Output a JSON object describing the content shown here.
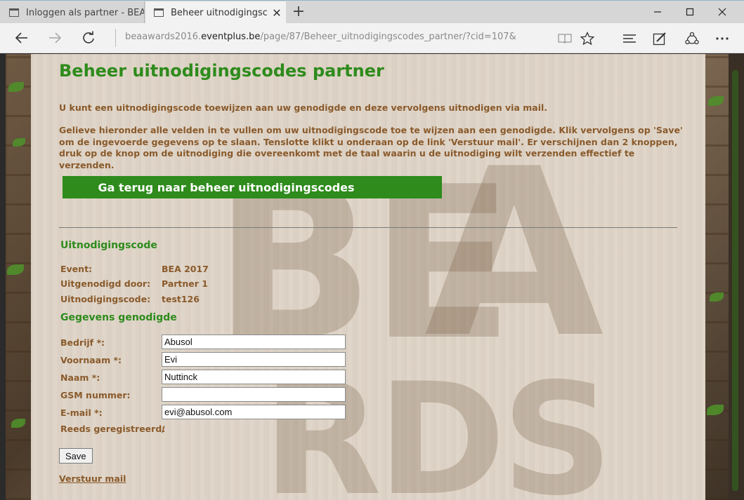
{
  "browser": {
    "tabs": [
      {
        "label": "Inloggen als partner - BEA A"
      },
      {
        "label": "Beheer uitnodigingscod"
      }
    ],
    "address": {
      "prefix": "beaawards2016.",
      "host": "eventplus.be",
      "path": "/page/87/Beheer_uitnodigingscodes_partner/?cid=107&"
    }
  },
  "page": {
    "title": "Beheer uitnodigingscodes partner",
    "intro1": "U kunt een uitnodigingscode toewijzen aan uw genodigde en deze vervolgens uitnodigen via mail.",
    "intro2": "Gelieve hieronder alle velden in te vullen om uw uitnodigingscode toe te wijzen aan een genodigde. Klik vervolgens op 'Save' om de ingevoerde gegevens op te slaan. Tenslotte klikt u onderaan op de link 'Verstuur mail'. Er verschijnen dan 2 knoppen, druk op de knop om de uitnodiging die overeenkomt met de taal waarin u de uitnodiging wilt verzenden effectief te verzenden.",
    "back_button": "Ga terug naar beheer uitnodigingscodes"
  },
  "code_section": {
    "title": "Uitnodigingscode",
    "rows": [
      {
        "label": "Event:",
        "value": "BEA 2017"
      },
      {
        "label": "Uitgenodigd door:",
        "value": "Partner 1"
      },
      {
        "label": "Uitnodigingscode:",
        "value": "test126"
      }
    ]
  },
  "guest_section": {
    "title": "Gegevens genodigde",
    "fields": [
      {
        "label": "Bedrijf *:",
        "value": "Abusol"
      },
      {
        "label": "Voornaam *:",
        "value": "Evi"
      },
      {
        "label": "Naam *:",
        "value": "Nuttinck"
      },
      {
        "label": "GSM nummer:",
        "value": ""
      },
      {
        "label": "E-mail *:",
        "value": "evi@abusol.com"
      }
    ],
    "registered_label": "Reeds geregistreerd:",
    "registered_value": "/"
  },
  "actions": {
    "save": "Save",
    "send_mail": "Verstuur mail"
  },
  "colors": {
    "accent_green": "#2e8b1c",
    "text_brown": "#8a5a2b"
  }
}
